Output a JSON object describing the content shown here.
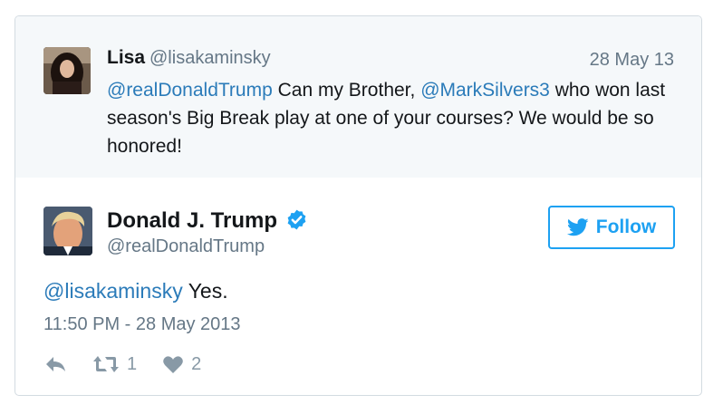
{
  "parent_tweet": {
    "name": "Lisa",
    "handle": "@lisakaminsky",
    "date": "28 May 13",
    "mention1": "@realDonaldTrump",
    "text1": " Can my Brother, ",
    "mention2": "@MarkSilvers3",
    "text2": " who won last season's Big Break play at one of your courses? We would be so honored!"
  },
  "main_tweet": {
    "name": "Donald J. Trump",
    "handle": "@realDonaldTrump",
    "follow_label": "Follow",
    "reply_mention": "@lisakaminsky",
    "text": " Yes.",
    "timestamp": "11:50 PM - 28 May 2013",
    "retweet_count": "1",
    "like_count": "2"
  },
  "colors": {
    "link": "#2b7bb9",
    "twitter_blue": "#1da1f2",
    "muted": "#657786",
    "parent_bg": "#f5f8fa"
  },
  "icons": [
    "verified-badge-icon",
    "twitter-bird-icon",
    "reply-icon",
    "retweet-icon",
    "heart-icon"
  ]
}
